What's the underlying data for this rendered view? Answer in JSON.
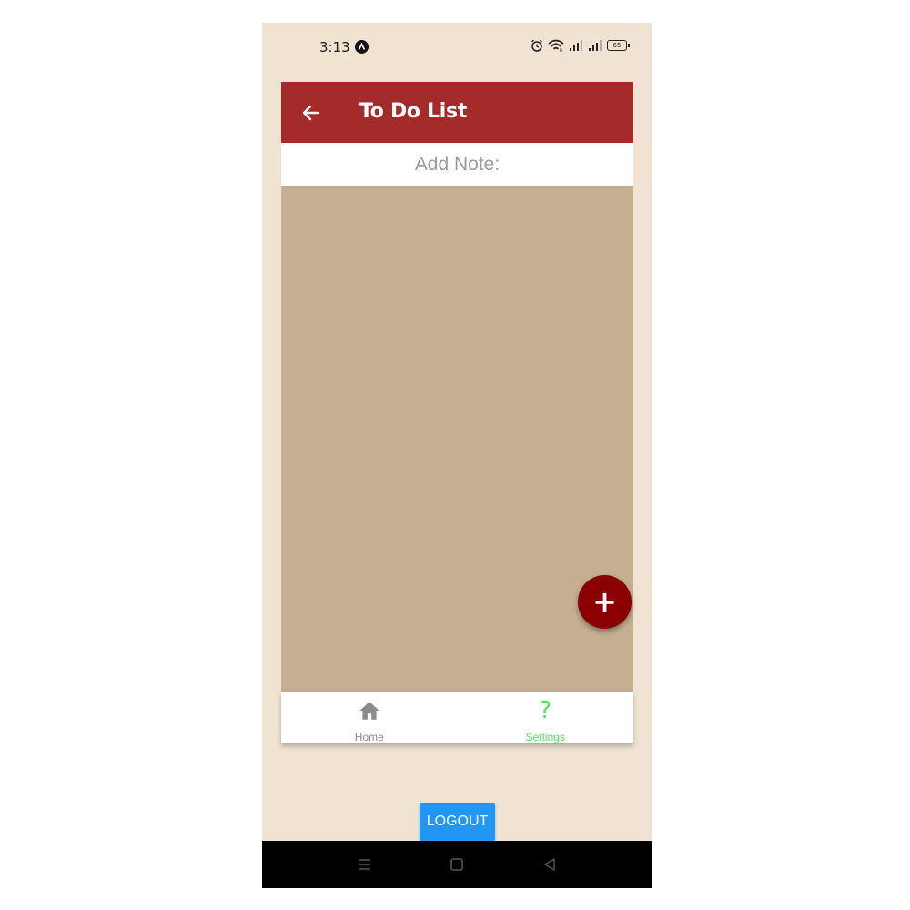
{
  "status_bar": {
    "time": "3:13",
    "battery": "65",
    "icons": [
      "app-notification-icon",
      "alarm-icon",
      "wifi-icon",
      "signal-icon",
      "signal-icon",
      "battery-icon"
    ]
  },
  "header": {
    "title": "To Do List",
    "back_icon": "arrow-back-icon",
    "background": "#a52a2a"
  },
  "add_note": {
    "placeholder": "Add Note:"
  },
  "content": {
    "background": "#c4af91"
  },
  "fab": {
    "label": "+",
    "color": "#8b0000"
  },
  "tabs": [
    {
      "label": "Home",
      "icon": "home-icon",
      "active": false,
      "color": "#8a8a8a"
    },
    {
      "label": "Settings",
      "icon": "question-icon",
      "active": true,
      "color": "#5ae05a"
    }
  ],
  "logout": {
    "label": "LOGOUT",
    "color": "#2196f3"
  },
  "nav_bar": {
    "buttons": [
      "menu-icon",
      "home-square-icon",
      "back-triangle-icon"
    ]
  }
}
